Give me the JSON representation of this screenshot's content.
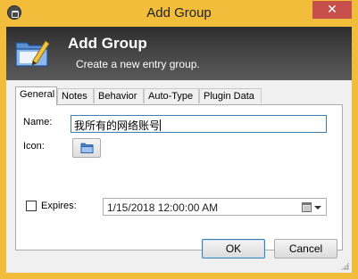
{
  "window": {
    "title": "Add Group",
    "close_glyph": "✕",
    "app_icon": "lock-icon"
  },
  "banner": {
    "title": "Add Group",
    "subtitle": "Create a new entry group.",
    "icon": "folder-edit-icon"
  },
  "tabs": [
    {
      "label": "General",
      "active": true
    },
    {
      "label": "Notes",
      "active": false
    },
    {
      "label": "Behavior",
      "active": false
    },
    {
      "label": "Auto-Type",
      "active": false
    },
    {
      "label": "Plugin Data",
      "active": false
    }
  ],
  "general": {
    "name_label": "Name:",
    "name_value": "我所有的网络账号",
    "icon_label": "Icon:",
    "icon_button": "folder-icon",
    "expires_label": "Expires:",
    "expires_checked": false,
    "expires_value": "1/15/2018 12:00:00 AM"
  },
  "buttons": {
    "ok": "OK",
    "cancel": "Cancel"
  },
  "colors": {
    "window_frame": "#f1bd3b",
    "close_button": "#c7504c",
    "focus_border": "#3c7fb1"
  }
}
